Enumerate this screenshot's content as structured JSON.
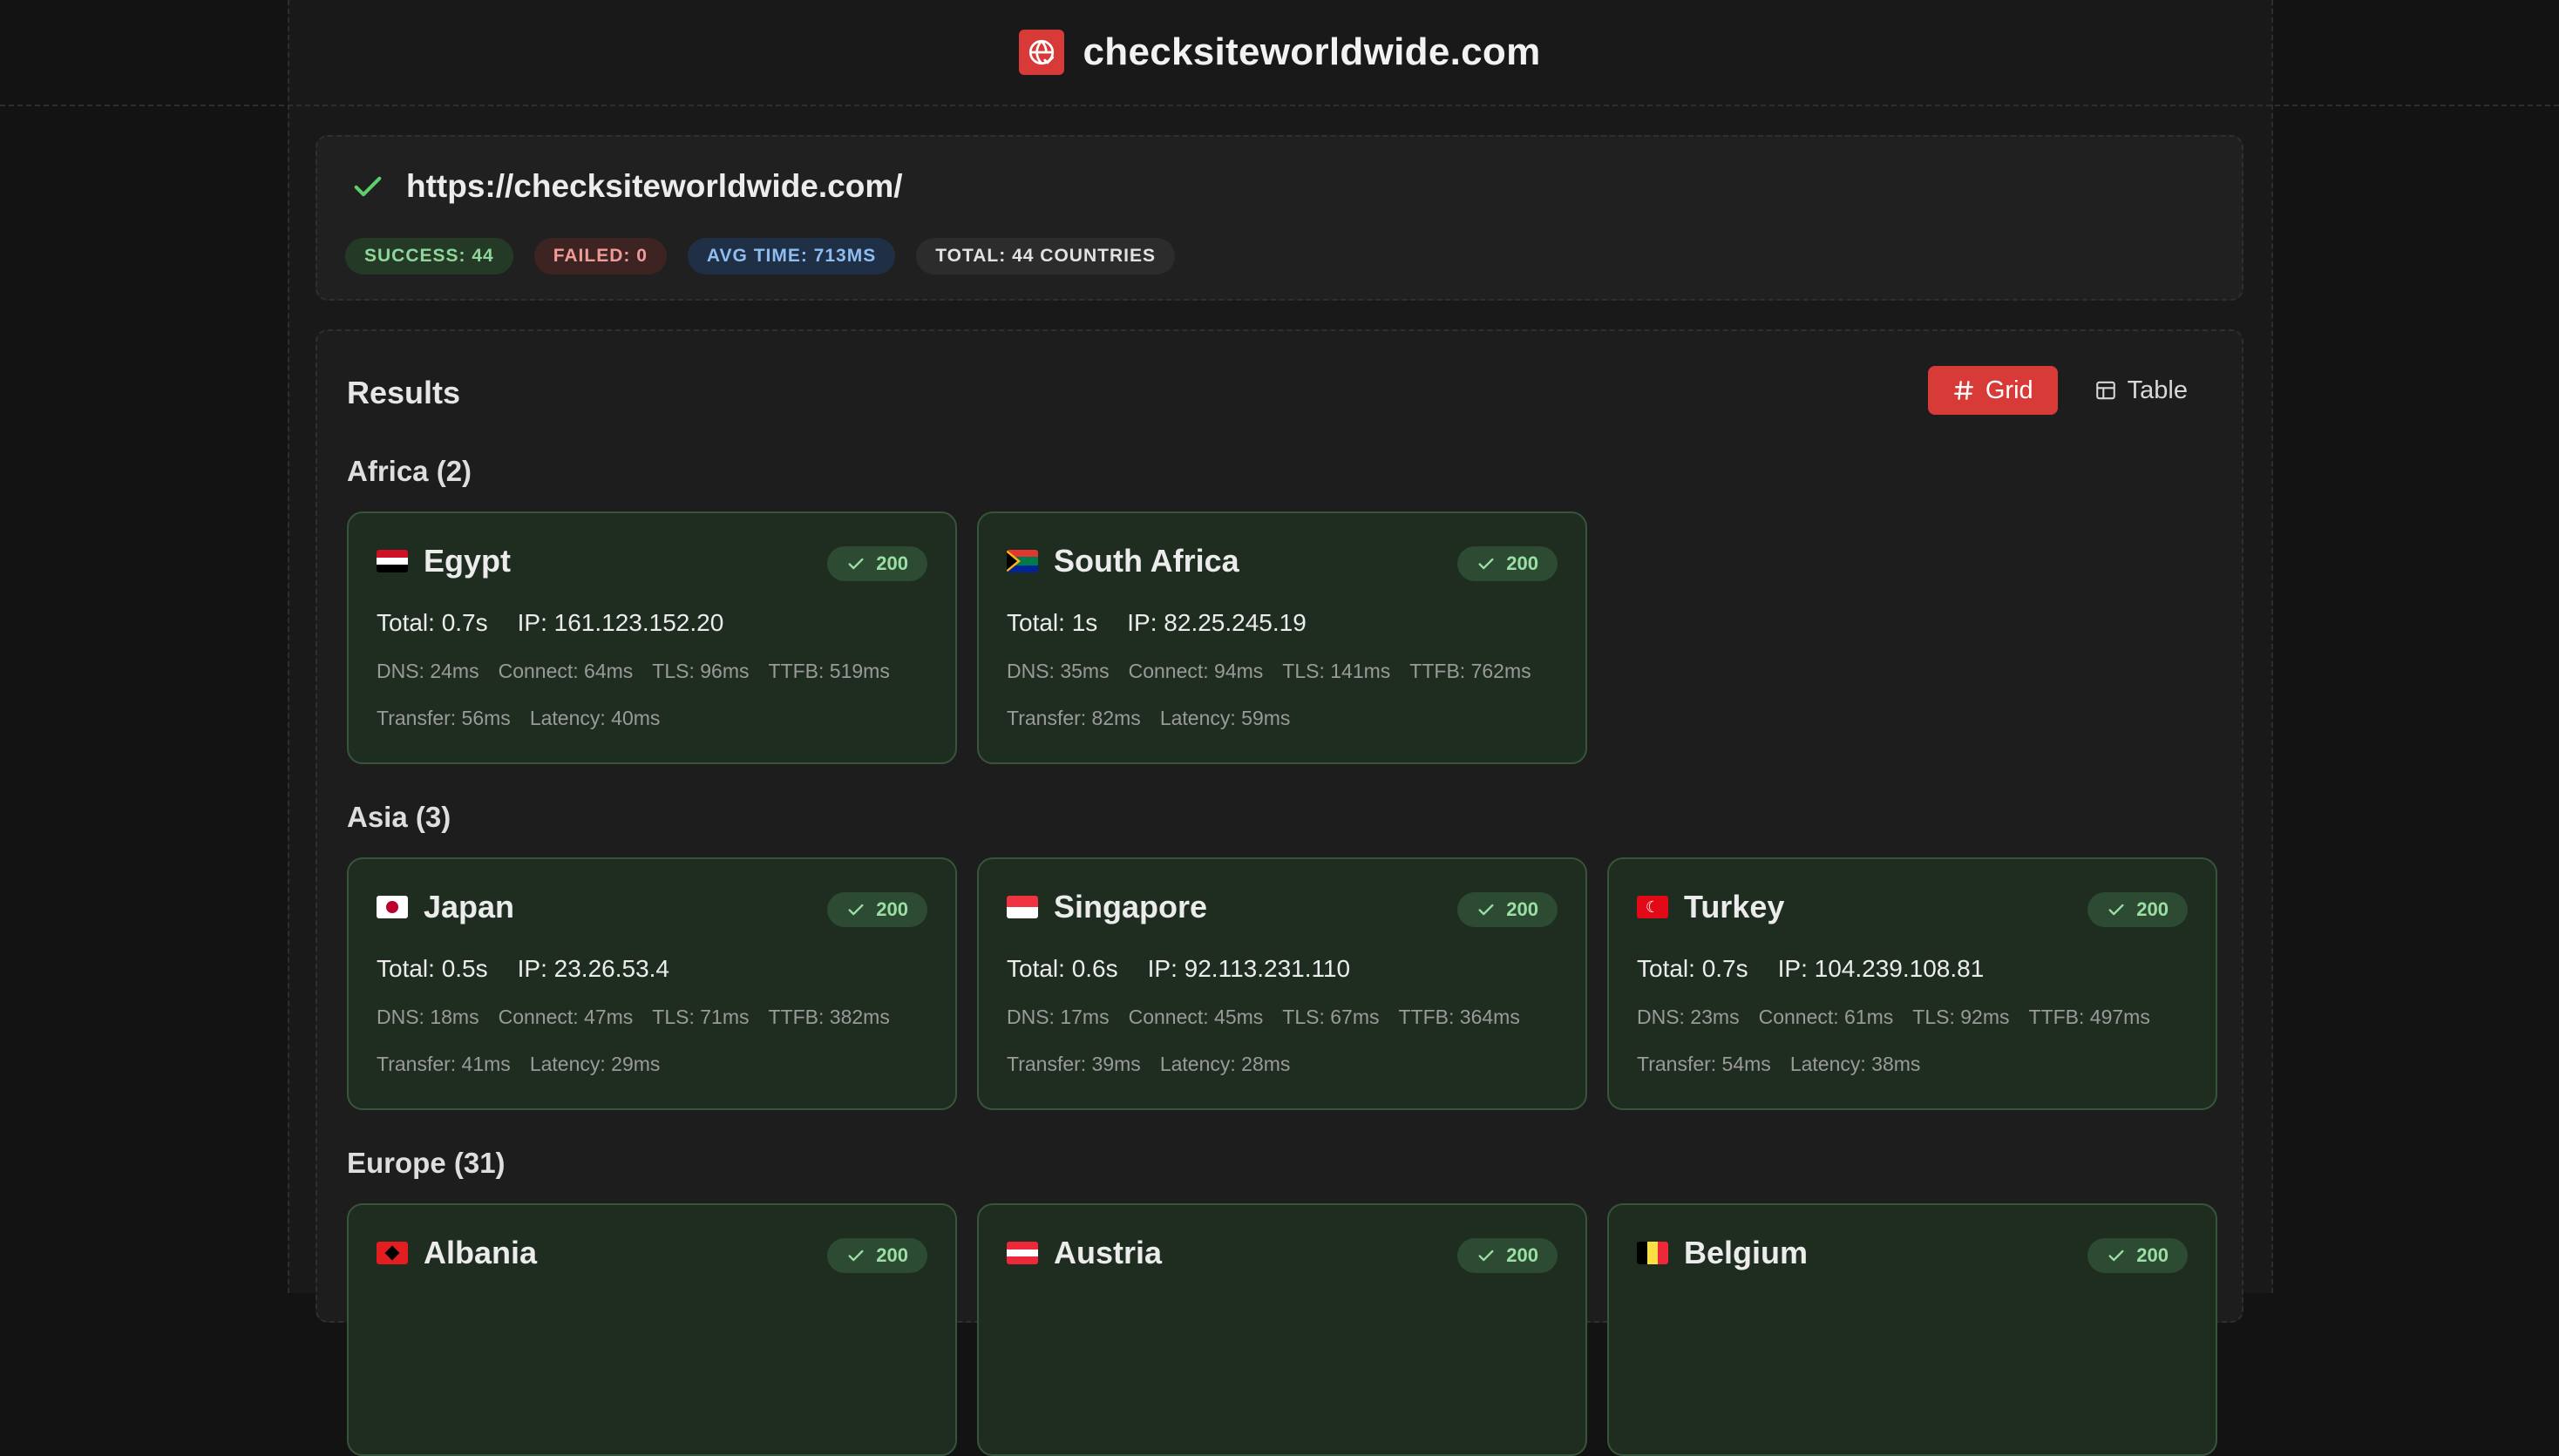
{
  "site": {
    "title": "checksiteworldwide.com"
  },
  "summary": {
    "url": "https://checksiteworldwide.com/",
    "success": "SUCCESS: 44",
    "failed": "FAILED: 0",
    "avg_time": "AVG TIME: 713MS",
    "total": "TOTAL: 44 COUNTRIES"
  },
  "results": {
    "title": "Results",
    "view_grid": "Grid",
    "view_table": "Table",
    "regions": [
      {
        "title": "Africa (2)"
      },
      {
        "title": "Asia (3)"
      },
      {
        "title": "Europe (31)"
      }
    ],
    "cards": [
      {
        "country": "Egypt",
        "status": "200",
        "total": "Total: 0.7s",
        "ip": "IP: 161.123.152.20",
        "dns": "DNS: 24ms",
        "connect": "Connect: 64ms",
        "tls": "TLS: 96ms",
        "ttfb": "TTFB: 519ms",
        "transfer": "Transfer: 56ms",
        "latency": "Latency: 40ms"
      },
      {
        "country": "South Africa",
        "status": "200",
        "total": "Total: 1s",
        "ip": "IP: 82.25.245.19",
        "dns": "DNS: 35ms",
        "connect": "Connect: 94ms",
        "tls": "TLS: 141ms",
        "ttfb": "TTFB: 762ms",
        "transfer": "Transfer: 82ms",
        "latency": "Latency: 59ms"
      },
      {
        "country": "Japan",
        "status": "200",
        "total": "Total: 0.5s",
        "ip": "IP: 23.26.53.4",
        "dns": "DNS: 18ms",
        "connect": "Connect: 47ms",
        "tls": "TLS: 71ms",
        "ttfb": "TTFB: 382ms",
        "transfer": "Transfer: 41ms",
        "latency": "Latency: 29ms"
      },
      {
        "country": "Singapore",
        "status": "200",
        "total": "Total: 0.6s",
        "ip": "IP: 92.113.231.110",
        "dns": "DNS: 17ms",
        "connect": "Connect: 45ms",
        "tls": "TLS: 67ms",
        "ttfb": "TTFB: 364ms",
        "transfer": "Transfer: 39ms",
        "latency": "Latency: 28ms"
      },
      {
        "country": "Turkey",
        "status": "200",
        "total": "Total: 0.7s",
        "ip": "IP: 104.239.108.81",
        "dns": "DNS: 23ms",
        "connect": "Connect: 61ms",
        "tls": "TLS: 92ms",
        "ttfb": "TTFB: 497ms",
        "transfer": "Transfer: 54ms",
        "latency": "Latency: 38ms"
      },
      {
        "country": "Albania",
        "status": "200"
      },
      {
        "country": "Austria",
        "status": "200"
      },
      {
        "country": "Belgium",
        "status": "200"
      }
    ]
  },
  "colors": {
    "accent": "#d83b37",
    "success": "#8fd69a",
    "card_bg": "#1f2d21",
    "card_border": "#36553b"
  },
  "icons": {
    "logo": "globe-check-icon",
    "url_status": "check-icon",
    "grid": "hash-icon",
    "table": "table-icon",
    "status": "check-icon"
  }
}
